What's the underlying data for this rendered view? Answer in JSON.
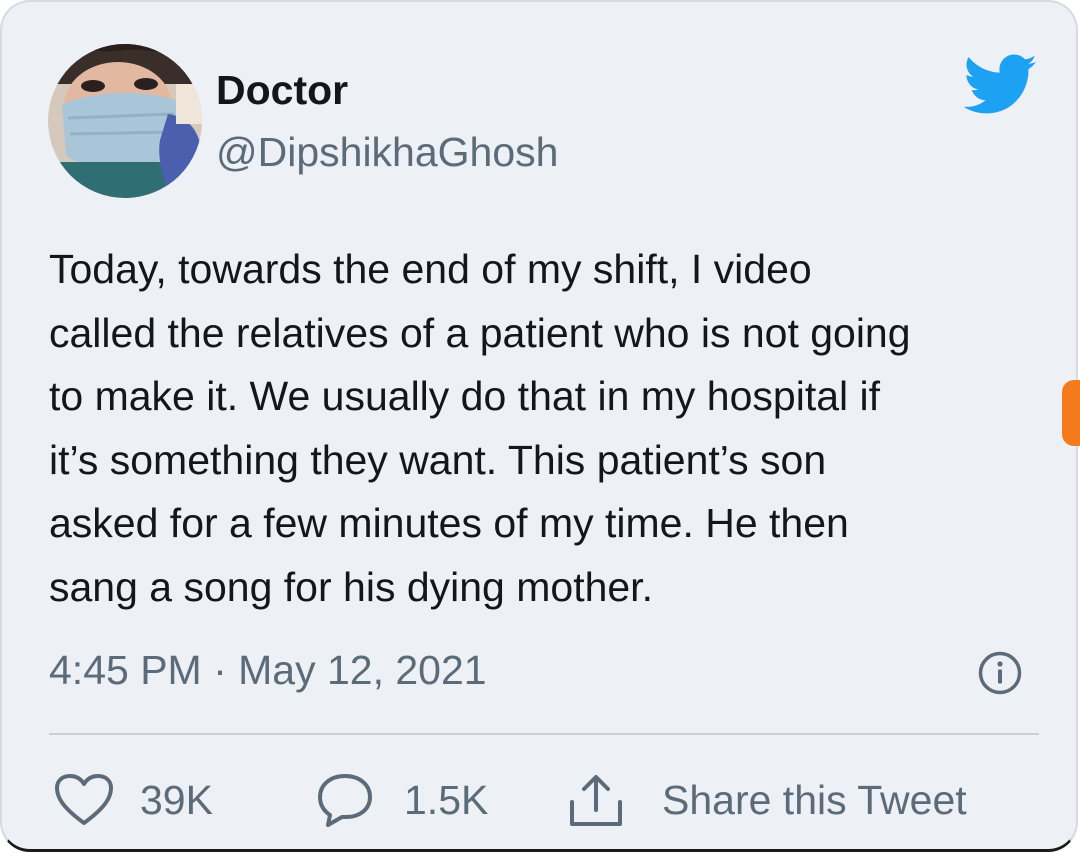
{
  "author": {
    "display_name": "Doctor",
    "handle": "@DipshikhaGhosh",
    "avatar_icon": "avatar-photo"
  },
  "brand": {
    "icon": "twitter-bird-icon",
    "color": "#1da1f2"
  },
  "tweet": {
    "lines": [
      "Today, towards the end of my shift, I video",
      "called the relatives of a patient who is not going",
      "to make it. We usually do that in my hospital if",
      "it’s something they want. This patient’s son",
      "asked for a few minutes of my time. He then",
      "sang a song for his dying mother."
    ],
    "timestamp": "4:45 PM · May 12, 2021"
  },
  "actions": {
    "likes": {
      "icon": "heart-icon",
      "count": "39K"
    },
    "replies": {
      "icon": "speech-bubble-icon",
      "count": "1.5K"
    },
    "share": {
      "icon": "share-icon",
      "label": "Share this Tweet"
    },
    "info_icon": "info-icon"
  },
  "colors": {
    "card_background": "#edf0f4",
    "text_primary": "#14171a",
    "text_secondary": "#5b6b7a",
    "edge_tab": "#f57a1c"
  }
}
